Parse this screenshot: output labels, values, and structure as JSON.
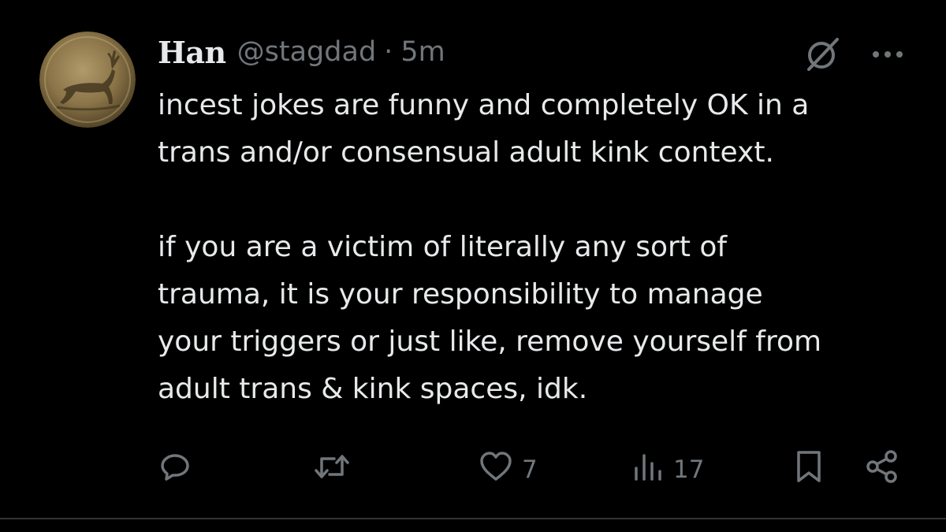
{
  "author": {
    "display_name": "Han",
    "handle": "@stagdad",
    "separator": "·",
    "time": "5m"
  },
  "post": {
    "text": "incest jokes are funny and completely OK in a\ntrans and/or consensual adult kink context.\n\nif you are a victim of literally any sort of\ntrauma, it is your responsibility to manage\nyour triggers or just like, remove yourself from\nadult trans & kink spaces, idk."
  },
  "metrics": {
    "likes": "7",
    "views": "17"
  },
  "icons": {
    "top": [
      "grok-icon",
      "more-icon"
    ],
    "actions": [
      "reply-icon",
      "repost-icon",
      "like-icon",
      "views-icon",
      "bookmark-icon",
      "share-icon"
    ]
  },
  "colors": {
    "background": "#000000",
    "text": "#e7e9ea",
    "secondary": "#71767b",
    "divider": "#2f3336"
  }
}
